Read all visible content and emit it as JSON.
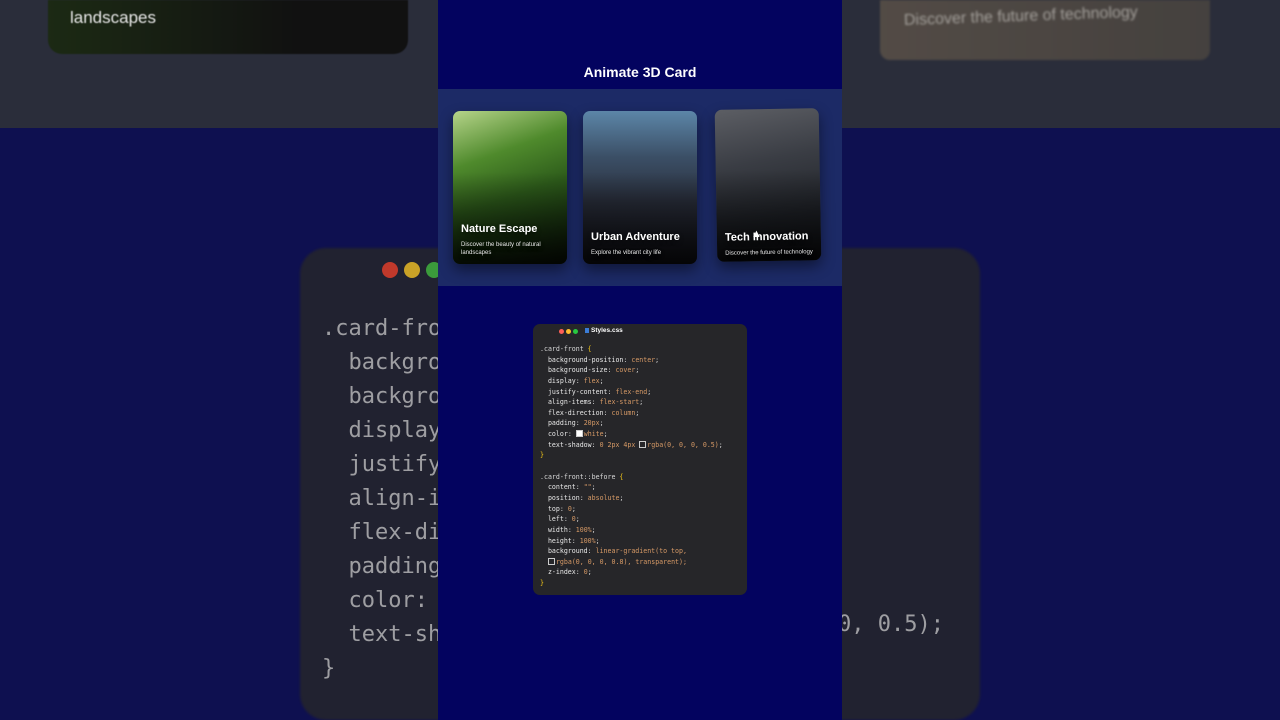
{
  "demo": {
    "title": "Animate 3D Card"
  },
  "cards": [
    {
      "title": "Nature Escape",
      "description": "Discover the beauty of natural landscapes"
    },
    {
      "title": "Urban Adventure",
      "description": "Explore the vibrant city life"
    },
    {
      "title": "Tech Innovation",
      "description": "Discover the future of technology"
    }
  ],
  "editor": {
    "filename": "Styles.css",
    "dot_colors": [
      "#ff5f57",
      "#febc2e",
      "#28c840"
    ],
    "lines": [
      ".card-front {",
      "  background-position: center;",
      "  background-size: cover;",
      "  display: flex;",
      "  justify-content: flex-end;",
      "  align-items: flex-start;",
      "  flex-direction: column;",
      "  padding: 20px;",
      "  color: white;",
      "  text-shadow: 0 2px 4px rgba(0, 0, 0, 0.5);",
      "}",
      "",
      ".card-front::before {",
      "  content: \"\";",
      "  position: absolute;",
      "  top: 0;",
      "  left: 0;",
      "  width: 100%;",
      "  height: 100%;",
      "  background: linear-gradient(to top,",
      "  rgba(0, 0, 0, 0.8), transparent);",
      "  z-index: 0;",
      "}"
    ]
  },
  "background": {
    "left_card_text": "landscapes",
    "right_card_text": "Discover the future of technology",
    "code_lines": [
      ".card-fro",
      "  backgro",
      "  backgro",
      "  display",
      "  justify",
      "  align-i",
      "  flex-di",
      "  padding",
      "  color:",
      "  text-sh",
      "}"
    ],
    "code_tail": "0, 0.5);"
  }
}
